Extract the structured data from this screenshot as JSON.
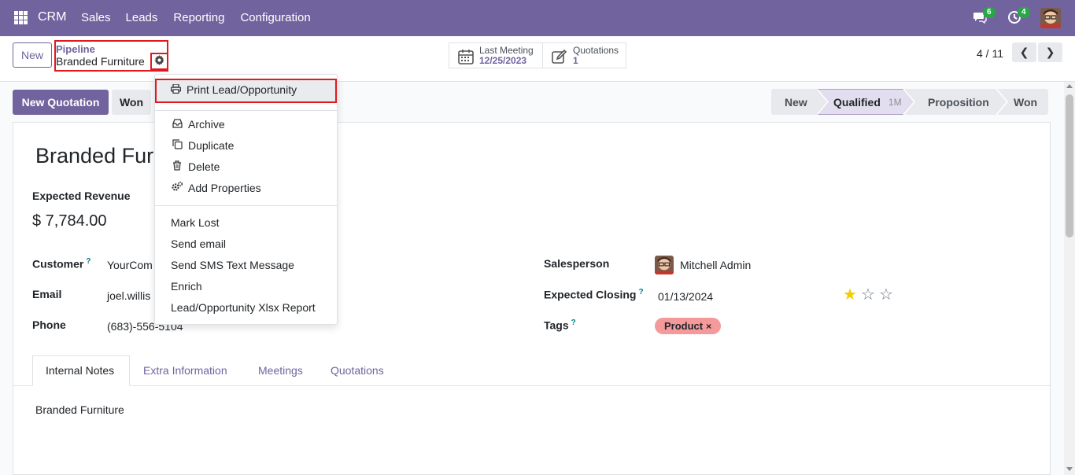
{
  "navbar": {
    "brand": "CRM",
    "menu": [
      "Sales",
      "Leads",
      "Reporting",
      "Configuration"
    ],
    "messages_count": "6",
    "activities_count": "4",
    "color": "#71639e"
  },
  "control": {
    "new_label": "New",
    "breadcrumb_parent": "Pipeline",
    "breadcrumb_current": "Branded Furniture",
    "last_meeting_label": "Last Meeting",
    "last_meeting_date": "12/25/2023",
    "quotations_label": "Quotations",
    "quotations_count": "1",
    "pager": "4 / 11"
  },
  "actions": {
    "new_quotation": "New Quotation",
    "won": "Won"
  },
  "stages": [
    {
      "label": "New"
    },
    {
      "label": "Qualified",
      "duration": "1M",
      "active": true
    },
    {
      "label": "Proposition"
    },
    {
      "label": "Won"
    }
  ],
  "form": {
    "title": "Branded Furniture",
    "expected_revenue_label": "Expected Revenue",
    "expected_revenue": "$ 7,784.00",
    "customer_label": "Customer",
    "customer_help": "?",
    "customer_value": "YourCom",
    "email_label": "Email",
    "email_value": "joel.willis",
    "phone_label": "Phone",
    "phone_value": "(683)-556-5104",
    "salesperson_label": "Salesperson",
    "salesperson_value": "Mitchell Admin",
    "expected_closing_label": "Expected Closing",
    "expected_closing_help": "?",
    "expected_closing_value": "01/13/2024",
    "tags_label": "Tags",
    "tags_help": "?",
    "tag": "Product",
    "tag_remove": "×",
    "priority_stars": 1,
    "star_color": "#f3cc00"
  },
  "tabs": [
    "Internal Notes",
    "Extra Information",
    "Meetings",
    "Quotations"
  ],
  "notes": "Branded Furniture",
  "dropdown": {
    "print": "Print Lead/Opportunity",
    "archive": "Archive",
    "duplicate": "Duplicate",
    "delete": "Delete",
    "add_properties": "Add Properties",
    "mark_lost": "Mark Lost",
    "send_email": "Send email",
    "send_sms": "Send SMS Text Message",
    "enrich": "Enrich",
    "xlsx_report": "Lead/Opportunity Xlsx Report"
  },
  "highlight_color": "#e0191f"
}
